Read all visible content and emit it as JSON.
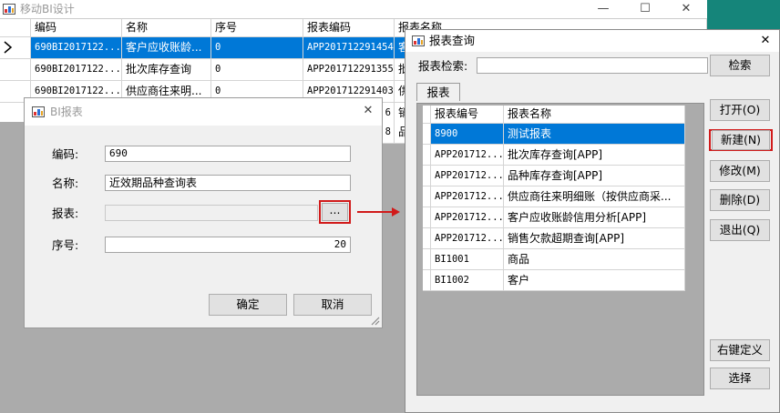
{
  "main_window": {
    "title": "移动BI设计",
    "columns": [
      "编码",
      "名称",
      "序号",
      "报表编码",
      "报表名称"
    ],
    "rows": [
      {
        "code": "690BI2017122...",
        "name": "客户应收账龄...",
        "order": "0",
        "report_code": "APP201712291454",
        "report_name": "客"
      },
      {
        "code": "690BI2017122...",
        "name": "批次库存查询",
        "order": "0",
        "report_code": "APP201712291355",
        "report_name": "批"
      },
      {
        "code": "690BI2017122...",
        "name": "供应商往来明...",
        "order": "0",
        "report_code": "APP201712291403",
        "report_name": "供"
      },
      {
        "code": "",
        "name": "",
        "order": "",
        "report_code": "6",
        "report_name": "销"
      },
      {
        "code": "",
        "name": "",
        "order": "",
        "report_code": "8",
        "report_name": "品"
      }
    ]
  },
  "bi_dialog": {
    "title": "BI报表",
    "fields": {
      "code_label": "编码:",
      "code_value": "690",
      "name_label": "名称:",
      "name_value": "近效期品种查询表",
      "report_label": "报表:",
      "report_value": "",
      "browse_label": "...",
      "order_label": "序号:",
      "order_value": "20"
    },
    "ok_label": "确定",
    "cancel_label": "取消"
  },
  "report_dialog": {
    "title": "报表查询",
    "search_label": "报表检索:",
    "search_value": "",
    "search_button": "检索",
    "tab_label": "报表",
    "columns": [
      "报表编号",
      "报表名称"
    ],
    "rows": [
      {
        "id": "8900",
        "name": "测试报表"
      },
      {
        "id": "APP201712...",
        "name": "批次库存查询[APP]"
      },
      {
        "id": "APP201712...",
        "name": "品种库存查询[APP]"
      },
      {
        "id": "APP201712...",
        "name": "供应商往来明细账（按供应商采..."
      },
      {
        "id": "APP201712...",
        "name": "客户应收账龄信用分析[APP]"
      },
      {
        "id": "APP201712...",
        "name": "销售欠款超期查询[APP]"
      },
      {
        "id": "BI1001",
        "name": "商品"
      },
      {
        "id": "BI1002",
        "name": "客户"
      }
    ],
    "buttons": {
      "open": "打开(O)",
      "new": "新建(N)",
      "edit": "修改(M)",
      "delete": "删除(D)",
      "exit": "退出(Q)",
      "right_define": "右键定义",
      "select": "选择"
    }
  },
  "colors": {
    "selection": "#0078d7",
    "highlight_red": "#d11a1a",
    "accent_green": "#15857a",
    "backdrop_gray": "#ababab"
  }
}
